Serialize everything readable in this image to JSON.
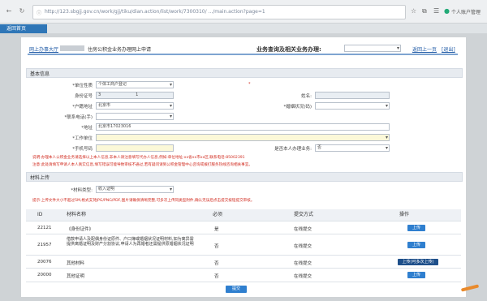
{
  "browser": {
    "url": "http://123.sbgjj.gov.cn/work/gjj/tiku/dian.action/list/work/7300310/ .../main.action?page=1",
    "toolbar_text": "个人账户管理",
    "tab_label": "返回首页"
  },
  "header": {
    "left_text": "网上办事大厅",
    "left_mid": "住房公积金业务办理",
    "left_end": "网上申请",
    "center_label": "业务查询及相关业务办理:",
    "link_home": "返回上一页",
    "link_exit": "[退出]"
  },
  "section_basic": {
    "title": "基本信息"
  },
  "form": {
    "unit_type_label": "*单位性质",
    "unit_type_value": "个体工商户登记",
    "id_label": "身份证号",
    "id_value": "3                           1",
    "name_label": "姓名:",
    "region_label": "*户籍地址",
    "region_value": "北京市",
    "marital_label": "*婚姻状况(码)",
    "phone_label": "*联系电话(手)",
    "address_label": "*地址",
    "address_value": "北京市17023016",
    "work_label": "*工作单位",
    "mobile_label": "*手机号码",
    "relation_label": "是否本人办理业务:",
    "relation_value": "否",
    "note_line1": "说明:办理本人公积金业务请选择以上本人信息,非本人请注意填写代办人信息,例如:单位地址:xx省xx市xx区,联系电话:85002391",
    "note_line2": "注意:此处请填写申请人本人真实信息,填写错误可能导致审核不通过,若有疑问请到公积金管理中心咨询或拨打服务热线咨询相关事宜。"
  },
  "section_attach": {
    "title": "材料上传"
  },
  "attach": {
    "type_label": "*材料类型:",
    "type_value": "收入证明",
    "note": "提示:上传文件大小不超过5M,格式支持JPG/PNG/PDF,图片请确保清晰完整,可多次上传同类型附件,确认无误后点击提交按钮提交审核。"
  },
  "table": {
    "headers": [
      "ID",
      "材料名称",
      "必须",
      "提交方式",
      "操作"
    ],
    "rows": [
      {
        "id": "22121",
        "name": "《身份证件》",
        "required": "是",
        "method": "在线提交",
        "action": "上传"
      },
      {
        "id": "21957",
        "name": "借款申请人及配偶身份证原件、户口簿或婚姻状况证明材料,如为离异需提供离婚证明及财产分割协议,申请人为再婚者还需提供原婚姻状况证明",
        "required": "否",
        "method": "在线提交",
        "action": "上传"
      },
      {
        "id": "20076",
        "name": "其他材料",
        "required": "否",
        "method": "在线提交",
        "action": "上传(可多次上传)"
      },
      {
        "id": "20000",
        "name": "其他证明",
        "required": "否",
        "method": "在线提交",
        "action": "上传"
      }
    ]
  },
  "submit_label": "提交",
  "colors": {
    "accent": "#2f7fcf",
    "header_line": "#7ea4d1",
    "warning": "#d12b1f"
  }
}
